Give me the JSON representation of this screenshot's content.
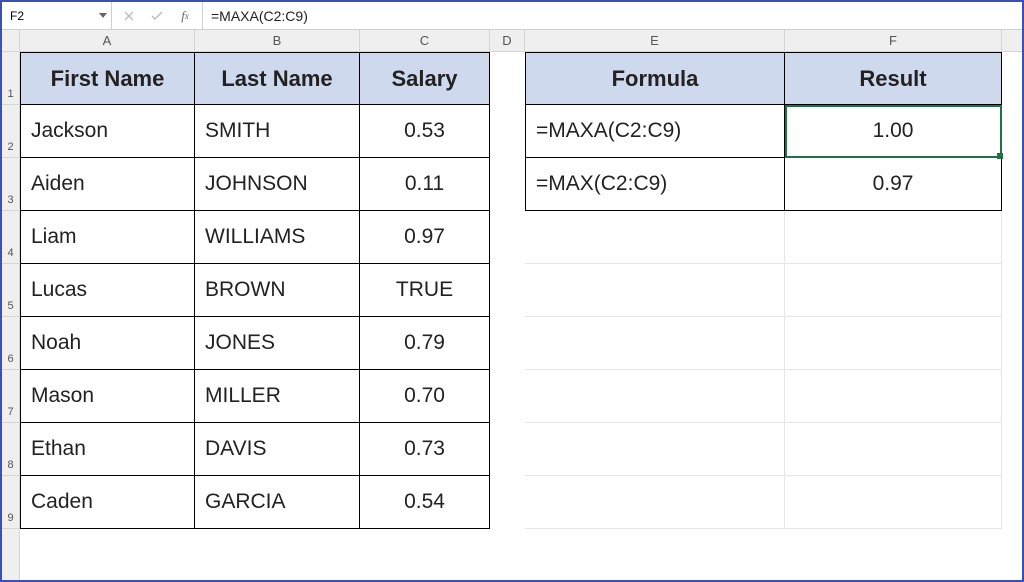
{
  "formula_bar": {
    "name_box": "F2",
    "formula": "=MAXA(C2:C9)"
  },
  "columns": {
    "A": "A",
    "B": "B",
    "C": "C",
    "D": "D",
    "E": "E",
    "F": "F"
  },
  "row_labels": [
    "1",
    "2",
    "3",
    "4",
    "5",
    "6",
    "7",
    "8",
    "9"
  ],
  "left_table": {
    "headers": {
      "first": "First Name",
      "last": "Last Name",
      "salary": "Salary"
    },
    "rows": [
      {
        "first": "Jackson",
        "last": "SMITH",
        "salary": "0.53"
      },
      {
        "first": "Aiden",
        "last": "JOHNSON",
        "salary": "0.11"
      },
      {
        "first": "Liam",
        "last": "WILLIAMS",
        "salary": "0.97"
      },
      {
        "first": "Lucas",
        "last": "BROWN",
        "salary": "TRUE"
      },
      {
        "first": "Noah",
        "last": "JONES",
        "salary": "0.79"
      },
      {
        "first": "Mason",
        "last": "MILLER",
        "salary": "0.70"
      },
      {
        "first": "Ethan",
        "last": "DAVIS",
        "salary": "0.73"
      },
      {
        "first": "Caden",
        "last": "GARCIA",
        "salary": "0.54"
      }
    ]
  },
  "right_table": {
    "headers": {
      "formula": "Formula",
      "result": "Result"
    },
    "rows": [
      {
        "formula": "=MAXA(C2:C9)",
        "result": "1.00"
      },
      {
        "formula": "=MAX(C2:C9)",
        "result": "0.97"
      }
    ]
  },
  "selected_cell": "F2"
}
